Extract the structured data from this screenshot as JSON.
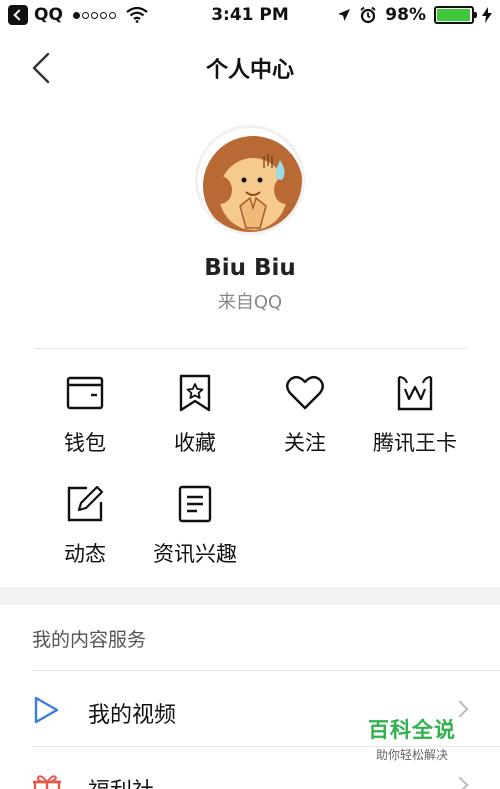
{
  "status_bar": {
    "carrier": "QQ",
    "signal_dots_filled": 1,
    "time": "3:41 PM",
    "battery_percent": "98%",
    "battery_level": 0.98,
    "battery_color": "#3fc83a"
  },
  "nav": {
    "title": "个人中心"
  },
  "profile": {
    "name": "Biu Biu",
    "source": "来自QQ"
  },
  "grid": {
    "wallet": "钱包",
    "favorites": "收藏",
    "follow": "关注",
    "tencent_card": "腾讯王卡",
    "moments": "动态",
    "interests": "资讯兴趣"
  },
  "section": {
    "title": "我的内容服务"
  },
  "list": {
    "videos": "我的视频",
    "welfare": "福利社"
  },
  "watermark": {
    "title": "百科全说",
    "subtitle": "助你轻松解决"
  },
  "colors": {
    "accent_blue": "#3b7ddd",
    "welfare_red": "#e8584a"
  }
}
